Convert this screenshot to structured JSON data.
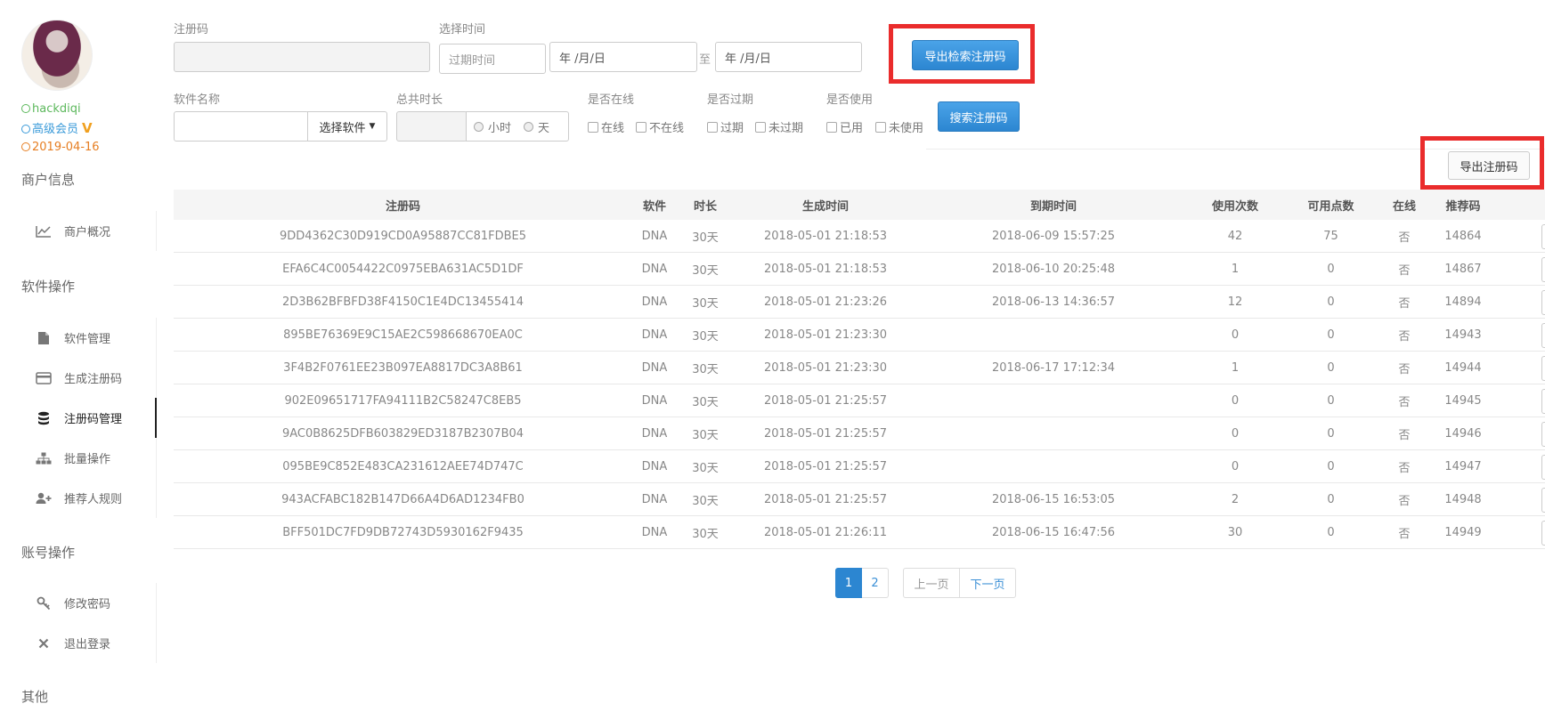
{
  "user": {
    "name": "hackdiqi",
    "level": "高级会员",
    "vip_mark": "V",
    "date": "2019-04-16"
  },
  "sidebar": {
    "section_merchant": "商户信息",
    "merchant_items": [
      {
        "label": "商户概况",
        "icon": "chart-line-icon"
      }
    ],
    "section_software": "软件操作",
    "software_items": [
      {
        "label": "软件管理",
        "icon": "file-icon"
      },
      {
        "label": "生成注册码",
        "icon": "credit-card-icon"
      },
      {
        "label": "注册码管理",
        "icon": "database-icon",
        "active": true
      },
      {
        "label": "批量操作",
        "icon": "sitemap-icon"
      },
      {
        "label": "推荐人规则",
        "icon": "user-plus-icon"
      }
    ],
    "section_account": "账号操作",
    "account_items": [
      {
        "label": "修改密码",
        "icon": "key-icon"
      },
      {
        "label": "退出登录",
        "icon": "close-icon"
      }
    ],
    "section_other": "其他"
  },
  "search": {
    "code_label": "注册码",
    "code_value": "",
    "time_label": "选择时间",
    "time_type_placeholder": "过期时间",
    "date_from_placeholder": "年 /月/日",
    "date_sep": "至",
    "date_to_placeholder": "年 /月/日",
    "export_search_button": "导出检索注册码",
    "software_label": "软件名称",
    "software_value": "",
    "select_software_button": "选择软件",
    "duration_label": "总共时长",
    "duration_value": "",
    "unit_hour": "小时",
    "unit_day": "天",
    "online_label": "是否在线",
    "online_yes": "在线",
    "online_no": "不在线",
    "expired_label": "是否过期",
    "expired_yes": "过期",
    "expired_no": "未过期",
    "used_label": "是否使用",
    "used_yes": "已用",
    "used_no": "未使用",
    "search_button": "搜索注册码",
    "export_button": "导出注册码"
  },
  "table": {
    "headers": [
      "注册码",
      "软件",
      "时长",
      "生成时间",
      "到期时间",
      "使用次数",
      "可用点数",
      "在线",
      "推荐码"
    ],
    "rows": [
      [
        "9DD4362C30D919CD0A95887CC81FDBE5",
        "DNA",
        "30天",
        "2018-05-01 21:18:53",
        "2018-06-09 15:57:25",
        "42",
        "75",
        "否",
        "14864"
      ],
      [
        "EFA6C4C0054422C0975EBA631AC5D1DF",
        "DNA",
        "30天",
        "2018-05-01 21:18:53",
        "2018-06-10 20:25:48",
        "1",
        "0",
        "否",
        "14867"
      ],
      [
        "2D3B62BFBFD38F4150C1E4DC13455414",
        "DNA",
        "30天",
        "2018-05-01 21:23:26",
        "2018-06-13 14:36:57",
        "12",
        "0",
        "否",
        "14894"
      ],
      [
        "895BE76369E9C15AE2C598668670EA0C",
        "DNA",
        "30天",
        "2018-05-01 21:23:30",
        "",
        "0",
        "0",
        "否",
        "14943"
      ],
      [
        "3F4B2F0761EE23B097EA8817DC3A8B61",
        "DNA",
        "30天",
        "2018-05-01 21:23:30",
        "2018-06-17 17:12:34",
        "1",
        "0",
        "否",
        "14944"
      ],
      [
        "902E09651717FA94111B2C58247C8EB5",
        "DNA",
        "30天",
        "2018-05-01 21:25:57",
        "",
        "0",
        "0",
        "否",
        "14945"
      ],
      [
        "9AC0B8625DFB603829ED3187B2307B04",
        "DNA",
        "30天",
        "2018-05-01 21:25:57",
        "",
        "0",
        "0",
        "否",
        "14946"
      ],
      [
        "095BE9C852E483CA231612AEE74D747C",
        "DNA",
        "30天",
        "2018-05-01 21:25:57",
        "",
        "0",
        "0",
        "否",
        "14947"
      ],
      [
        "943ACFABC182B147D66A4D6AD1234FB0",
        "DNA",
        "30天",
        "2018-05-01 21:25:57",
        "2018-06-15 16:53:05",
        "2",
        "0",
        "否",
        "14948"
      ],
      [
        "BFF501DC7FD9DB72743D5930162F9435",
        "DNA",
        "30天",
        "2018-05-01 21:26:11",
        "2018-06-15 16:47:56",
        "30",
        "0",
        "否",
        "14949"
      ]
    ]
  },
  "pagination": {
    "pages": [
      "1",
      "2"
    ],
    "current": "1",
    "prev": "上一页",
    "next": "下一页"
  },
  "colors": {
    "primary": "#2c86d1",
    "highlight_box": "#ea2c2c",
    "user_name": "#5cb85c",
    "user_level": "#3a9ad9",
    "user_date": "#e67e22"
  }
}
